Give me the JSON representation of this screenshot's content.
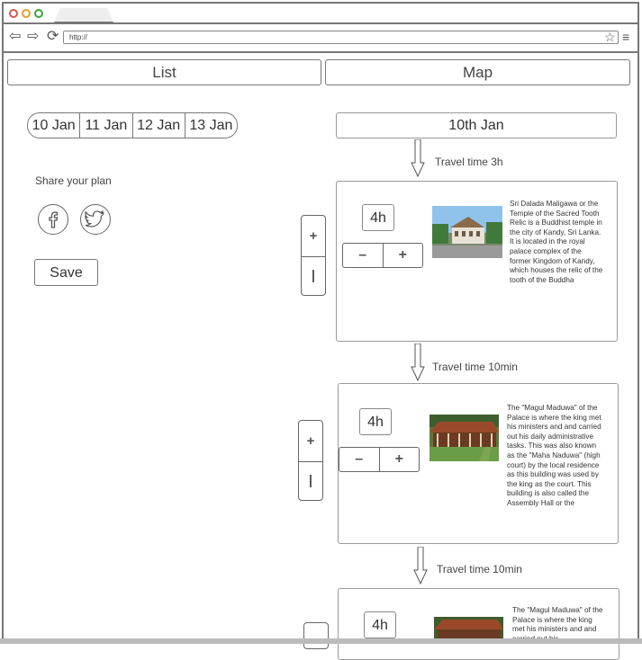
{
  "browser": {
    "url": "http://"
  },
  "tabs": {
    "list": "List",
    "map": "Map"
  },
  "dates": [
    "10 Jan",
    "11 Jan",
    "12 Jan",
    "13 Jan"
  ],
  "share": {
    "label": "Share your plan",
    "save": "Save"
  },
  "day": {
    "title": "10th Jan"
  },
  "travel": [
    "Travel time 3h",
    "Travel time 10min",
    "Travel time 10min"
  ],
  "stops": [
    {
      "hours": "4h",
      "description": "Sri Dalada Maligawa or the Temple of the Sacred Tooth Relic is a Buddhist temple in the city of Kandy, Sri Lanka. It is located in the royal palace complex of the former Kingdom of Kandy, which houses the relic of the tooth of the Buddha"
    },
    {
      "hours": "4h",
      "description": "The \"Magul Maduwa\" of the Palace is where the king met his ministers and and carried out his daily administrative tasks. This was also known as the \"Maha Naduwa\" (high court) by the local residence as this building was used by the king as the court. This building is also called the Assembly Hall or the"
    },
    {
      "hours": "4h",
      "description": "The \"Magul Maduwa\" of the Palace is where the king met his ministers and and carried out his"
    }
  ],
  "controls": {
    "minus": "–",
    "plus": "+",
    "side_plus": "+",
    "side_divider": "|"
  }
}
